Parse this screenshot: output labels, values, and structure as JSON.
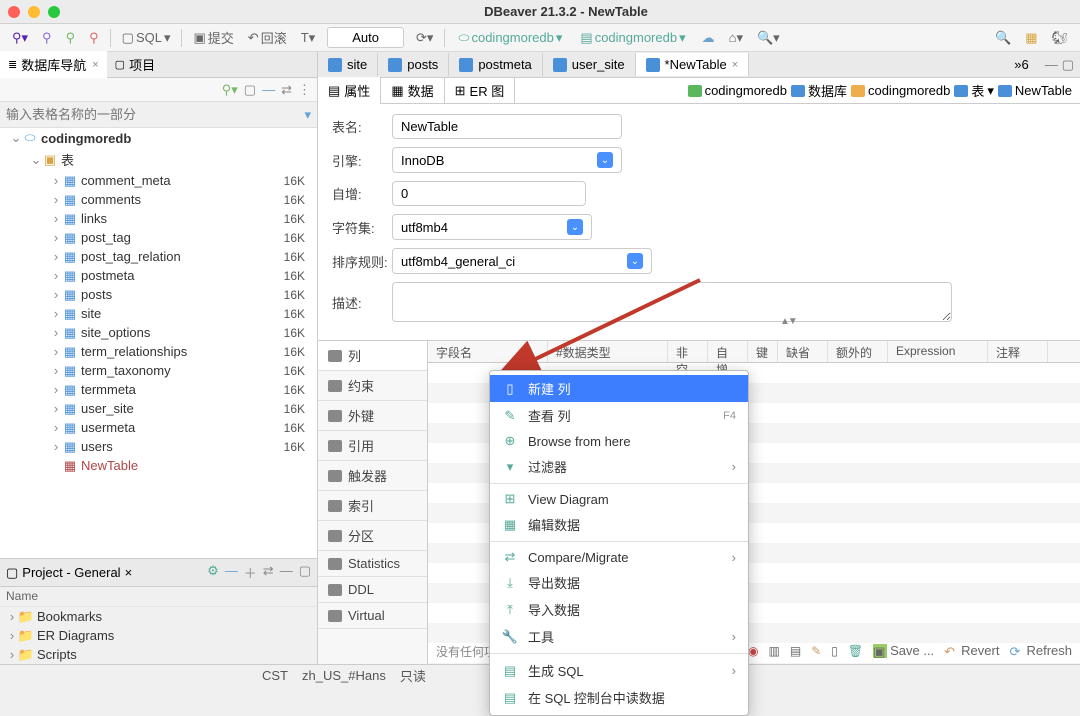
{
  "title": "DBeaver 21.3.2 - NewTable",
  "toolbar": {
    "sql_label": "SQL",
    "commit": "提交",
    "rollback": "回滚",
    "mode": "Auto",
    "db1": "codingmoredb",
    "db2": "codingmoredb"
  },
  "left_tabs": {
    "nav": "数据库导航",
    "proj": "项目"
  },
  "search_placeholder": "输入表格名称的一部分",
  "tree": {
    "root": "codingmoredb",
    "tables_label": "表",
    "items": [
      {
        "name": "comment_meta",
        "size": "16K"
      },
      {
        "name": "comments",
        "size": "16K"
      },
      {
        "name": "links",
        "size": "16K"
      },
      {
        "name": "post_tag",
        "size": "16K"
      },
      {
        "name": "post_tag_relation",
        "size": "16K"
      },
      {
        "name": "postmeta",
        "size": "16K"
      },
      {
        "name": "posts",
        "size": "16K"
      },
      {
        "name": "site",
        "size": "16K"
      },
      {
        "name": "site_options",
        "size": "16K"
      },
      {
        "name": "term_relationships",
        "size": "16K"
      },
      {
        "name": "term_taxonomy",
        "size": "16K"
      },
      {
        "name": "termmeta",
        "size": "16K"
      },
      {
        "name": "user_site",
        "size": "16K"
      },
      {
        "name": "usermeta",
        "size": "16K"
      },
      {
        "name": "users",
        "size": "16K"
      }
    ],
    "new_table": "NewTable"
  },
  "project": {
    "title": "Project - General",
    "col_name": "Name",
    "items": [
      "Bookmarks",
      "ER Diagrams",
      "Scripts"
    ]
  },
  "editor_tabs": [
    "site",
    "posts",
    "postmeta",
    "user_site",
    "*NewTable"
  ],
  "overflow_tab": "»6",
  "sub_tabs": {
    "props": "属性",
    "data": "数据",
    "er": "ER 图"
  },
  "breadcrumbs": [
    "codingmoredb",
    "数据库",
    "codingmoredb",
    "表",
    "NewTable"
  ],
  "props": {
    "name_lbl": "表名:",
    "name_val": "NewTable",
    "engine_lbl": "引擎:",
    "engine_val": "InnoDB",
    "autoinc_lbl": "自增:",
    "autoinc_val": "0",
    "charset_lbl": "字符集:",
    "charset_val": "utf8mb4",
    "collation_lbl": "排序规则:",
    "collation_val": "utf8mb4_general_ci",
    "desc_lbl": "描述:"
  },
  "side_tabs": [
    "列",
    "约束",
    "外键",
    "引用",
    "触发器",
    "索引",
    "分区",
    "Statistics",
    "DDL",
    "Virtual"
  ],
  "grid_headers": [
    "字段名",
    "#数据类型",
    "非空",
    "自增",
    "键",
    "缺省",
    "额外的",
    "Expression",
    "注释"
  ],
  "empty_text": "没有任何项",
  "context_menu": {
    "new_col": "新建 列",
    "view_col": "查看 列",
    "view_col_key": "F4",
    "browse": "Browse from here",
    "filter": "过滤器",
    "view_diagram": "View Diagram",
    "edit_data": "编辑数据",
    "compare": "Compare/Migrate",
    "export": "导出数据",
    "import": "导入数据",
    "tools": "工具",
    "gen_sql": "生成 SQL",
    "read_sql": "在 SQL 控制台中读数据"
  },
  "bottom_actions": {
    "save": "Save ...",
    "revert": "Revert",
    "refresh": "Refresh"
  },
  "status": {
    "cst": "CST",
    "locale": "zh_US_#Hans",
    "readonly": "只读"
  }
}
